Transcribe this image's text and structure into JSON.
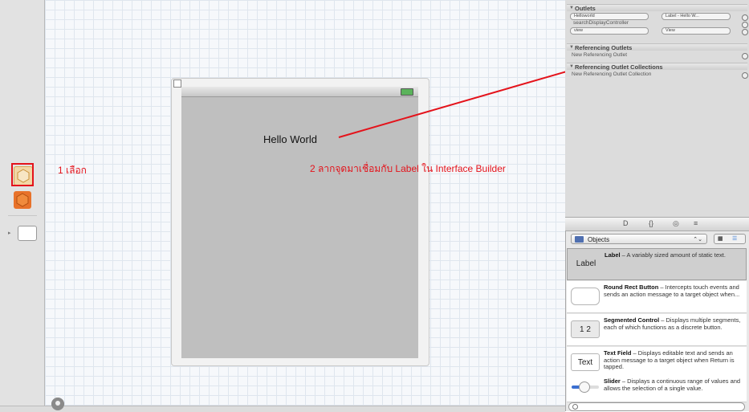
{
  "canvas": {
    "hello_label": "Hello World"
  },
  "annotations": {
    "step1": "1 เลือก",
    "step2": "2 ลากจุดมาเชื่อมกับ Label ใน Interface Builder"
  },
  "connections": {
    "outlets_title": "Outlets",
    "outlets": [
      {
        "name": "Helloworld",
        "target": "Label - Hello W..."
      },
      {
        "name": "searchDisplayController",
        "target": ""
      },
      {
        "name": "view",
        "target": "View"
      }
    ],
    "ref_outlets_title": "Referencing Outlets",
    "new_ref_outlet": "New Referencing Outlet",
    "ref_collections_title": "Referencing Outlet Collections",
    "new_ref_collection": "New Referencing Outlet Collection"
  },
  "library": {
    "tabs": [
      "D",
      "{}",
      "◎",
      "≡"
    ],
    "selector": "Objects",
    "items": [
      {
        "thumb": "Label",
        "name": "Label",
        "desc": " – A variably sized amount of static text."
      },
      {
        "thumb": "",
        "name": "Round Rect Button",
        "desc": " – Intercepts touch events and sends an action message to a target object when..."
      },
      {
        "thumb": "1 2",
        "name": "Segmented Control",
        "desc": " – Displays multiple segments, each of which functions as a discrete button."
      },
      {
        "thumb": "Text",
        "name": "Text Field",
        "desc": " – Displays editable text and sends an action message to a target object when Return is tapped."
      },
      {
        "thumb": "",
        "name": "Slider",
        "desc": " – Displays a continuous range of values and allows the selection of a single value."
      }
    ]
  },
  "colors": {
    "annotation": "#e4131b",
    "screen": "#bfbfbf"
  }
}
